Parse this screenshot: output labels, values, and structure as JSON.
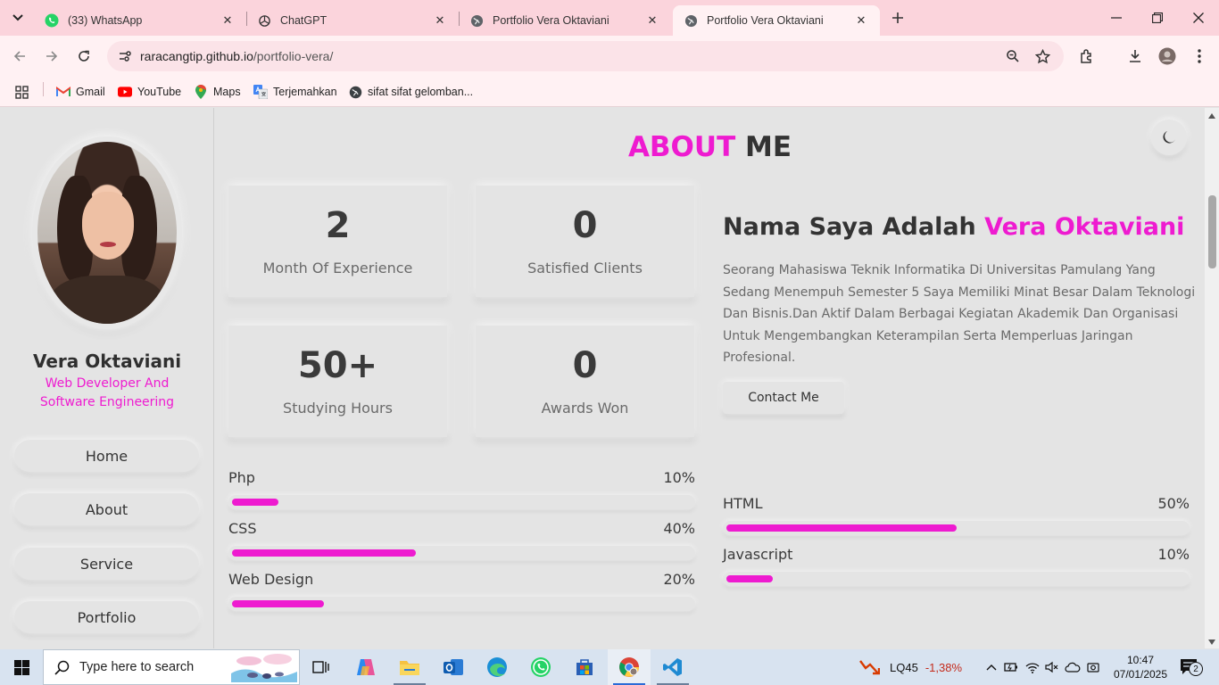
{
  "browser": {
    "tabs": [
      {
        "title": "(33) WhatsApp",
        "icon": "whatsapp-icon",
        "active": false
      },
      {
        "title": "ChatGPT",
        "icon": "chatgpt-icon",
        "active": false
      },
      {
        "title": "Portfolio Vera Oktaviani",
        "icon": "globe-icon",
        "active": false
      },
      {
        "title": "Portfolio Vera Oktaviani",
        "icon": "globe-icon",
        "active": true
      }
    ],
    "url_host": "raracangtip.github.io",
    "url_path": "/portfolio-vera/",
    "bookmarks": [
      {
        "label": "Gmail",
        "icon": "gmail-icon"
      },
      {
        "label": "YouTube",
        "icon": "youtube-icon"
      },
      {
        "label": "Maps",
        "icon": "maps-icon"
      },
      {
        "label": "Terjemahkan",
        "icon": "translate-icon"
      },
      {
        "label": "sifat sifat gelomban...",
        "icon": "globe-icon"
      }
    ]
  },
  "sidebar": {
    "name": "Vera Oktaviani",
    "role": "Web Developer And Software Engineering",
    "nav": [
      "Home",
      "About",
      "Service",
      "Portfolio"
    ]
  },
  "about": {
    "title_accent": "ABOUT",
    "title_rest": " ME",
    "stats": [
      {
        "number": "2",
        "label": "Month Of Experience"
      },
      {
        "number": "0",
        "label": "Satisfied Clients"
      },
      {
        "number": "50+",
        "label": "Studying Hours"
      },
      {
        "number": "0",
        "label": "Awards Won"
      }
    ],
    "heading_prefix": "Nama Saya Adalah ",
    "heading_name": "Vera Oktaviani",
    "description": "Seorang Mahasiswa Teknik Informatika Di Universitas Pamulang Yang Sedang Menempuh Semester 5 Saya Memiliki Minat Besar Dalam Teknologi Dan Bisnis.Dan Aktif Dalam Berbagai Kegiatan Akademik Dan Organisasi Untuk Mengembangkan Keterampilan Serta Memperluas Jaringan Profesional.",
    "contact_button": "Contact Me",
    "skills_left": [
      {
        "name": "Php",
        "percent": "10%",
        "value": 10
      },
      {
        "name": "CSS",
        "percent": "40%",
        "value": 40
      },
      {
        "name": "Web Design",
        "percent": "20%",
        "value": 20
      }
    ],
    "skills_right": [
      {
        "name": "HTML",
        "percent": "50%",
        "value": 50
      },
      {
        "name": "Javascript",
        "percent": "10%",
        "value": 10
      }
    ]
  },
  "colors": {
    "accent": "#ee1bd0",
    "background": "#e4e4e4",
    "text": "#333333"
  },
  "taskbar": {
    "search_placeholder": "Type here to search",
    "stock_name": "LQ45",
    "stock_change": "-1,38%",
    "time": "10:47",
    "date": "07/01/2025",
    "notification_count": "2"
  }
}
